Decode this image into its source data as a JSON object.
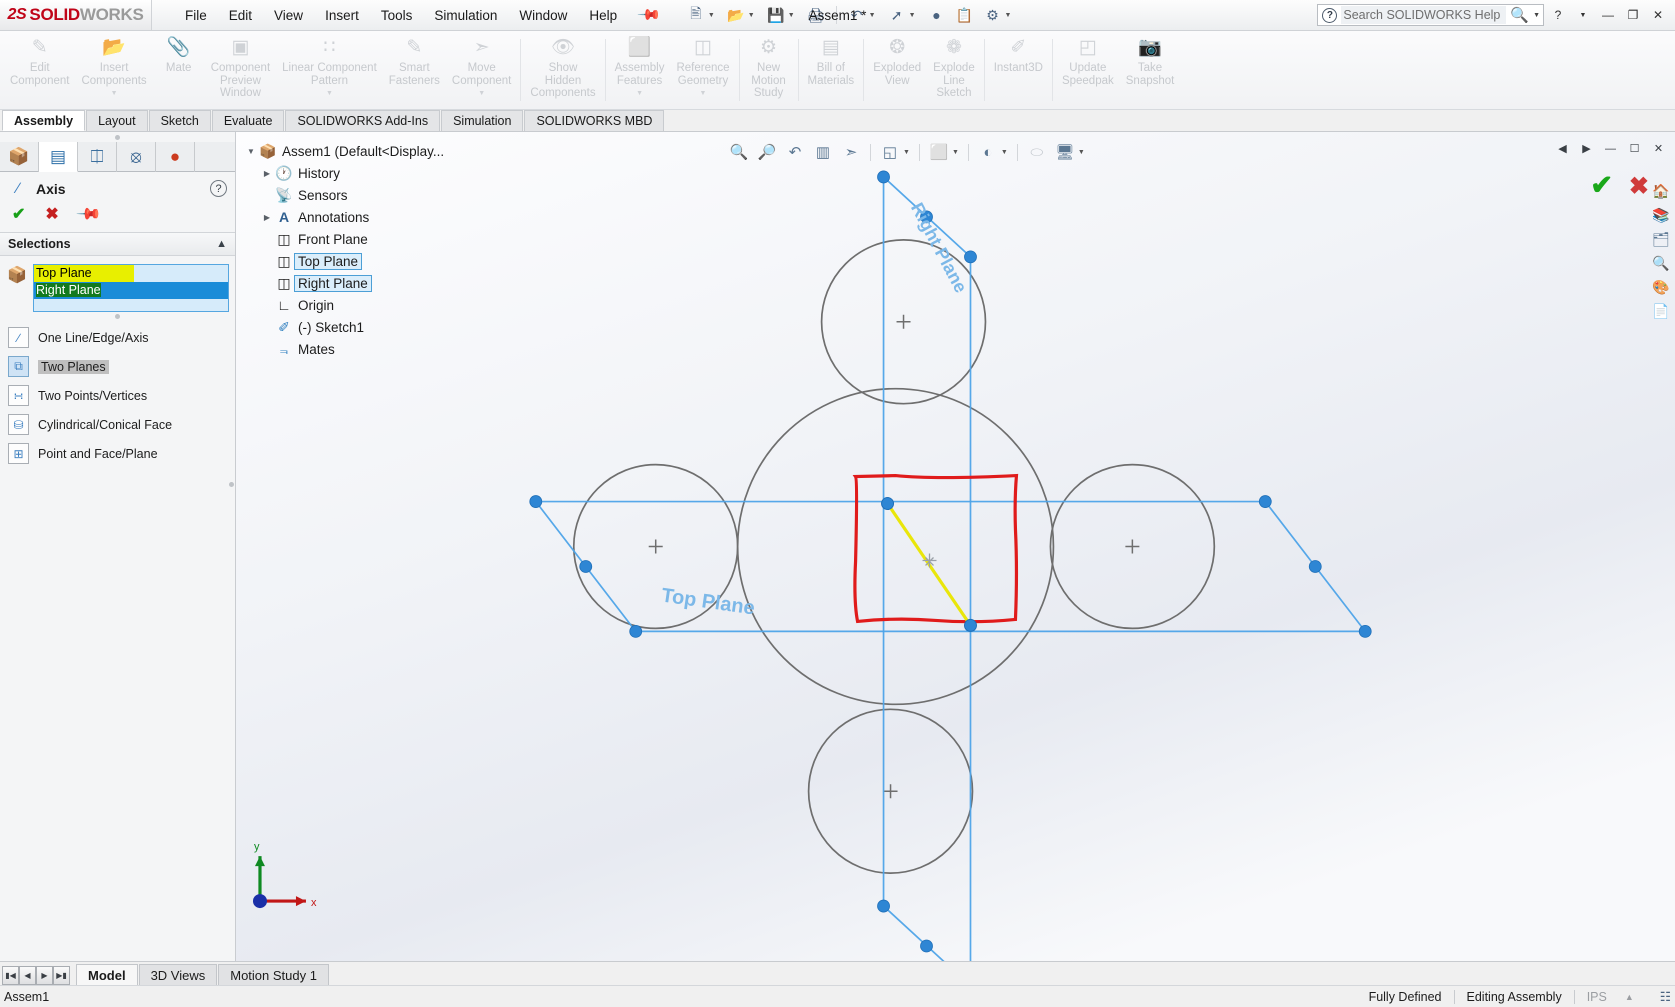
{
  "app": {
    "brand_ds": "2S",
    "brand_bold": "SOLID",
    "brand_light": "WORKS",
    "document_title": "Assem1 *",
    "accent_red": "#c00418",
    "accent_blue": "#1a8cd8",
    "selection_yellow": "#e8ef00",
    "selection_green": "#127a1e"
  },
  "menu": {
    "items": [
      {
        "label": "File"
      },
      {
        "label": "Edit"
      },
      {
        "label": "View"
      },
      {
        "label": "Insert"
      },
      {
        "label": "Tools"
      },
      {
        "label": "Simulation"
      },
      {
        "label": "Window"
      },
      {
        "label": "Help"
      }
    ],
    "pin_icon": "pushpin-icon"
  },
  "quick_access": [
    {
      "name": "new-document-icon",
      "glyph": "⬜",
      "caret": true
    },
    {
      "name": "open-document-icon",
      "glyph": "📂",
      "caret": true
    },
    {
      "name": "save-icon",
      "glyph": "💾",
      "caret": true
    },
    {
      "name": "print-icon",
      "glyph": "🖨",
      "caret": false
    },
    {
      "name": "undo-icon",
      "glyph": "↶",
      "caret": true
    },
    {
      "name": "redo-icon",
      "glyph": "↷",
      "caret": true
    },
    {
      "name": "select-arrow-icon",
      "glyph": "↖",
      "caret": true
    },
    {
      "name": "rebuild-icon",
      "glyph": "🔴",
      "caret": false
    },
    {
      "name": "file-properties-icon",
      "glyph": "📋",
      "caret": false
    },
    {
      "name": "options-gear-icon",
      "glyph": "⚙",
      "caret": true
    }
  ],
  "help_search": {
    "placeholder": "Search SOLIDWORKS Help",
    "question_icon": "question-circle-icon",
    "magnifier_icon": "search-icon"
  },
  "window_controls": {
    "help": "?",
    "minimize": "—",
    "maximize": "❐",
    "close": "✕"
  },
  "ribbon": {
    "groups": [
      {
        "items": [
          {
            "label": "Edit\nComponent",
            "icon": "edit-component-icon",
            "glyph": "✎",
            "caret": false
          },
          {
            "label": "Insert\nComponents",
            "icon": "insert-components-icon",
            "glyph": "📁",
            "caret": true
          },
          {
            "label": "Mate",
            "icon": "mate-icon",
            "glyph": "📎",
            "caret": false
          },
          {
            "label": "Component\nPreview\nWindow",
            "icon": "component-preview-window-icon",
            "glyph": "▣",
            "caret": false
          },
          {
            "label": "Linear Component\nPattern",
            "icon": "linear-component-pattern-icon",
            "glyph": "∷",
            "caret": true
          },
          {
            "label": "Smart\nFasteners",
            "icon": "smart-fasteners-icon",
            "glyph": "🔩",
            "caret": false
          },
          {
            "label": "Move\nComponent",
            "icon": "move-component-icon",
            "glyph": "✣",
            "caret": true
          }
        ]
      },
      {
        "items": [
          {
            "label": "Show\nHidden\nComponents",
            "icon": "show-hidden-components-icon",
            "glyph": "👁",
            "caret": false
          }
        ]
      },
      {
        "items": [
          {
            "label": "Assembly\nFeatures",
            "icon": "assembly-features-icon",
            "glyph": "⬛",
            "caret": true
          },
          {
            "label": "Reference\nGeometry",
            "icon": "reference-geometry-icon",
            "glyph": "◫",
            "caret": true
          }
        ]
      },
      {
        "items": [
          {
            "label": "New\nMotion\nStudy",
            "icon": "new-motion-study-icon",
            "glyph": "⚙",
            "caret": false
          }
        ]
      },
      {
        "items": [
          {
            "label": "Bill of\nMaterials",
            "icon": "bill-of-materials-icon",
            "glyph": "▤",
            "caret": false
          }
        ]
      },
      {
        "items": [
          {
            "label": "Exploded\nView",
            "icon": "exploded-view-icon",
            "glyph": "❂",
            "caret": false
          },
          {
            "label": "Explode\nLine\nSketch",
            "icon": "explode-line-sketch-icon",
            "glyph": "❁",
            "caret": false
          }
        ]
      },
      {
        "items": [
          {
            "label": "Instant3D",
            "icon": "instant3d-icon",
            "glyph": "✐",
            "caret": false
          }
        ]
      },
      {
        "items": [
          {
            "label": "Update\nSpeedpak",
            "icon": "update-speedpak-icon",
            "glyph": "◰",
            "caret": false
          },
          {
            "label": "Take\nSnapshot",
            "icon": "take-snapshot-icon",
            "glyph": "📷",
            "caret": false
          }
        ]
      }
    ]
  },
  "command_tabs": {
    "active": "Assembly",
    "items": [
      {
        "label": "Assembly"
      },
      {
        "label": "Layout"
      },
      {
        "label": "Sketch"
      },
      {
        "label": "Evaluate"
      },
      {
        "label": "SOLIDWORKS Add-Ins"
      },
      {
        "label": "Simulation"
      },
      {
        "label": "SOLIDWORKS MBD"
      }
    ]
  },
  "property_manager": {
    "tabs": [
      {
        "name": "feature-manager-tree-tab",
        "glyph": "📦",
        "selected": false
      },
      {
        "name": "property-manager-tab",
        "glyph": "☰",
        "selected": true
      },
      {
        "name": "configuration-manager-tab",
        "glyph": "⎇",
        "selected": false
      },
      {
        "name": "dimxpert-manager-tab",
        "glyph": "⊕",
        "selected": false
      },
      {
        "name": "display-manager-tab",
        "glyph": "◕",
        "selected": false
      }
    ],
    "title": "Axis",
    "title_icon": "axis-icon",
    "help_icon": "help-circle-icon",
    "actions": {
      "ok": "✔",
      "cancel": "✖",
      "pin": "✒"
    },
    "section": {
      "label": "Selections",
      "collapse_icon": "chevron-up-icon"
    },
    "selection_items": [
      {
        "label": "Top Plane",
        "style": "highlight-yellow"
      },
      {
        "label": "Right Plane",
        "style": "selected-blue-green"
      }
    ],
    "options": [
      {
        "label": "One Line/Edge/Axis",
        "icon": "one-line-edge-axis-icon",
        "glyph": "╱",
        "active": false
      },
      {
        "label": "Two Planes",
        "icon": "two-planes-icon",
        "glyph": "⧉",
        "active": true
      },
      {
        "label": "Two Points/Vertices",
        "icon": "two-points-vertices-icon",
        "glyph": "∴",
        "active": false
      },
      {
        "label": "Cylindrical/Conical Face",
        "icon": "cylindrical-conical-face-icon",
        "glyph": "⛁",
        "active": false
      },
      {
        "label": "Point and Face/Plane",
        "icon": "point-and-face-plane-icon",
        "glyph": "⊞",
        "active": false
      }
    ]
  },
  "feature_tree": {
    "nodes": [
      {
        "label": "Assem1  (Default<Display...",
        "icon": "assembly-icon",
        "glyph": "📦",
        "indent": 0,
        "arrow": "down",
        "selected": false
      },
      {
        "label": "History",
        "icon": "history-icon",
        "glyph": "🕒",
        "indent": 1,
        "arrow": "right",
        "selected": false
      },
      {
        "label": "Sensors",
        "icon": "sensors-icon",
        "glyph": "📡",
        "indent": 1,
        "arrow": "none",
        "selected": false
      },
      {
        "label": "Annotations",
        "icon": "annotations-icon",
        "glyph": "A",
        "indent": 1,
        "arrow": "right",
        "selected": false
      },
      {
        "label": "Front Plane",
        "icon": "plane-icon",
        "glyph": "◫",
        "indent": 1,
        "arrow": "none",
        "selected": false
      },
      {
        "label": "Top Plane",
        "icon": "plane-icon",
        "glyph": "◫",
        "indent": 1,
        "arrow": "none",
        "selected": true
      },
      {
        "label": "Right Plane",
        "icon": "plane-icon",
        "glyph": "◫",
        "indent": 1,
        "arrow": "none",
        "selected": true
      },
      {
        "label": "Origin",
        "icon": "origin-icon",
        "glyph": "∟",
        "indent": 1,
        "arrow": "none",
        "selected": false
      },
      {
        "label": "(-) Sketch1",
        "icon": "sketch-icon",
        "glyph": "✐",
        "indent": 1,
        "arrow": "none",
        "selected": false
      },
      {
        "label": "Mates",
        "icon": "mates-icon",
        "glyph": "⫼",
        "indent": 1,
        "arrow": "none",
        "selected": false
      }
    ]
  },
  "heads_up_toolbar": {
    "buttons": [
      {
        "name": "zoom-to-fit-icon",
        "glyph": "🔍",
        "caret": false
      },
      {
        "name": "zoom-to-area-icon",
        "glyph": "🔎",
        "caret": false
      },
      {
        "name": "previous-view-icon",
        "glyph": "↶",
        "caret": false
      },
      {
        "name": "section-view-icon",
        "glyph": "▥",
        "caret": false
      },
      {
        "name": "view-orientation-icon",
        "glyph": "✣",
        "caret": false
      },
      {
        "name": "display-style-icon",
        "glyph": "◱",
        "caret": true
      },
      {
        "name": "hide-show-items-icon",
        "glyph": "⬛",
        "caret": true
      },
      {
        "name": "edit-appearance-icon",
        "glyph": "◐",
        "caret": true
      },
      {
        "name": "apply-scene-icon",
        "glyph": "⬭",
        "caret": true
      },
      {
        "name": "view-settings-icon",
        "glyph": "🖥",
        "caret": true
      }
    ]
  },
  "graphics": {
    "plane_labels": [
      {
        "text": "Right Plane",
        "name": "right-plane-label"
      },
      {
        "text": "Top Plane",
        "name": "top-plane-label"
      }
    ],
    "triad": {
      "x_label": "x",
      "y_label": "y"
    },
    "confirm_corner": {
      "ok_icon": "confirm-ok-icon",
      "cancel_icon": "confirm-cancel-icon"
    },
    "right_panel_icons": [
      {
        "name": "view-palette-icon",
        "glyph": "🏠"
      },
      {
        "name": "design-library-icon",
        "glyph": "📚"
      },
      {
        "name": "file-explorer-icon",
        "glyph": "🗂"
      },
      {
        "name": "search-library-icon",
        "glyph": "🔍"
      },
      {
        "name": "appearances-icon",
        "glyph": "🎨"
      },
      {
        "name": "custom-properties-icon",
        "glyph": "📄"
      }
    ],
    "window_buttons": [
      {
        "name": "collapse-left-icon",
        "glyph": "◀"
      },
      {
        "name": "expand-right-icon",
        "glyph": "▶"
      },
      {
        "name": "doc-minimize-icon",
        "glyph": "—"
      },
      {
        "name": "doc-restore-icon",
        "glyph": "❐"
      },
      {
        "name": "doc-close-icon",
        "glyph": "✕"
      }
    ]
  },
  "dock_tabs": {
    "active": "Model",
    "items": [
      {
        "label": "Model"
      },
      {
        "label": "3D Views"
      },
      {
        "label": "Motion Study 1"
      }
    ],
    "nav_buttons": [
      "⏮",
      "◀",
      "▶",
      "⏭"
    ]
  },
  "status_bar": {
    "document": "Assem1",
    "state": "Fully Defined",
    "mode": "Editing Assembly",
    "units": "IPS",
    "units_caret": "▲",
    "overlay_icon": "layers-icon"
  }
}
